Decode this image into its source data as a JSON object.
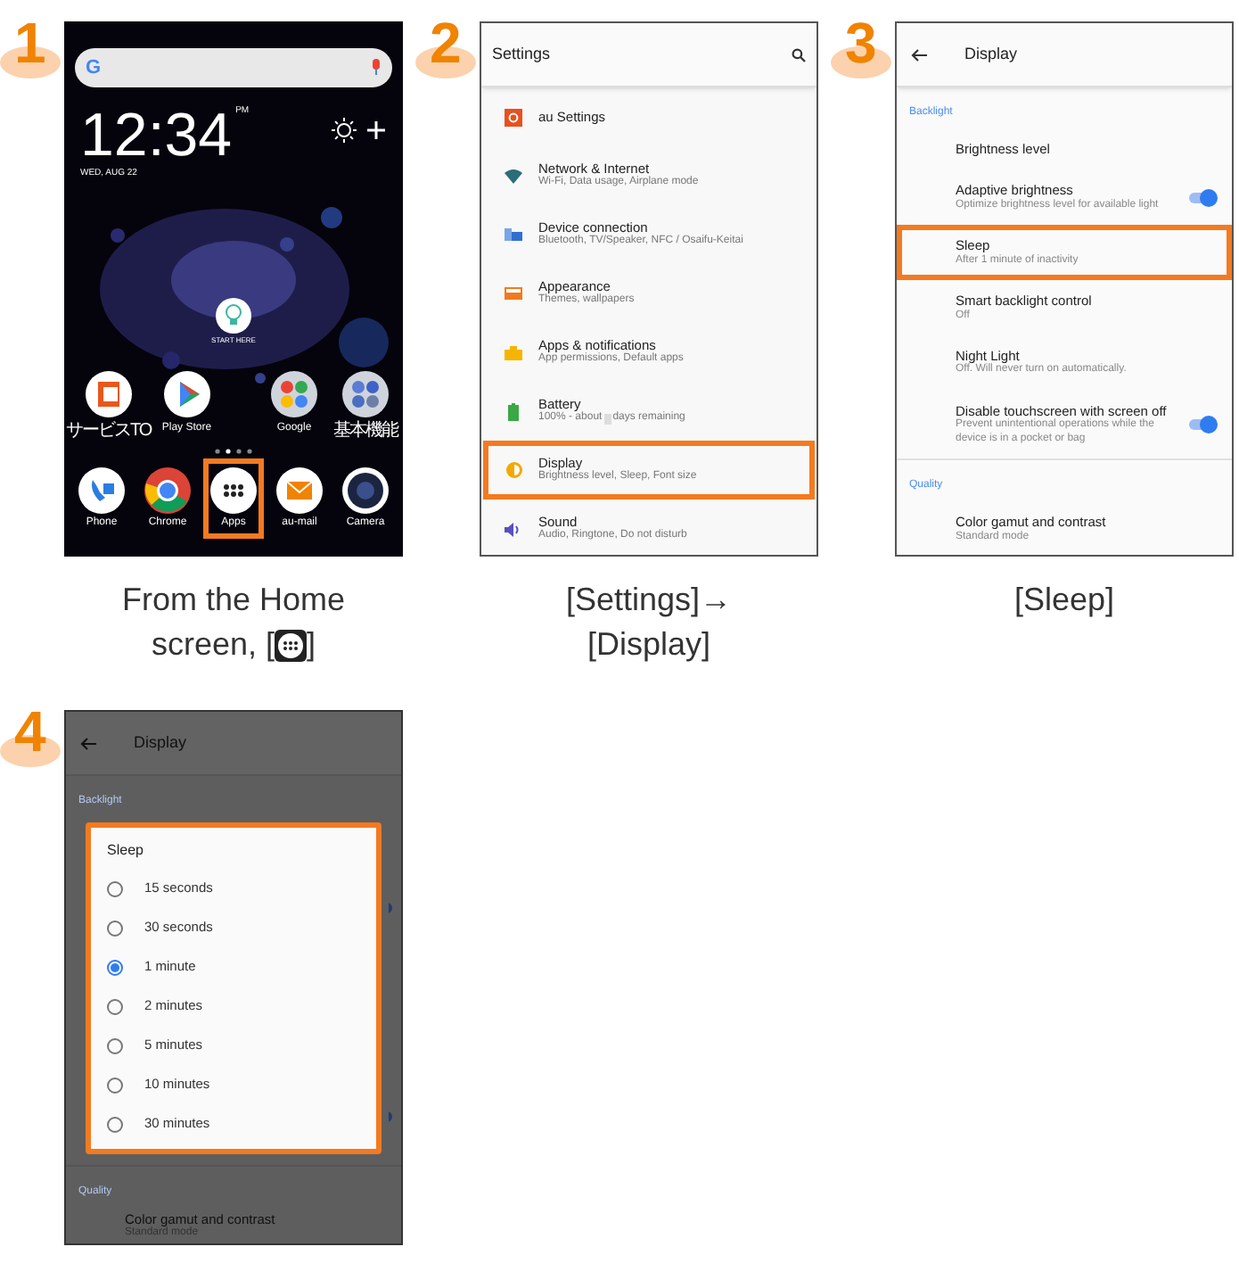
{
  "steps": [
    {
      "number": "1",
      "screen": {
        "kind": "home",
        "search_logo": "G",
        "time": "12:34",
        "ampm": "PM",
        "date": "WED, AUG 22",
        "start_here": "START HERE",
        "apps": [
          {
            "label": "サービスTO",
            "kind": "au"
          },
          {
            "label": "Play Store",
            "kind": "play"
          },
          {
            "label": "Google",
            "kind": "google-folder"
          },
          {
            "label": "基本機能",
            "kind": "basic-folder"
          }
        ],
        "dock": [
          {
            "label": "Phone",
            "kind": "phone",
            "highlighted": false
          },
          {
            "label": "Chrome",
            "kind": "chrome",
            "highlighted": false
          },
          {
            "label": "Apps",
            "kind": "apps",
            "highlighted": true
          },
          {
            "label": "au-mail",
            "kind": "mail",
            "highlighted": false
          },
          {
            "label": "Camera",
            "kind": "camera",
            "highlighted": false
          }
        ]
      },
      "caption": {
        "lines": [
          "From the Home",
          "screen, ["
        ],
        "after_icon": "]"
      }
    },
    {
      "number": "2",
      "screen": {
        "kind": "settings",
        "title": "Settings",
        "items": [
          {
            "title": "au Settings",
            "kind": "au",
            "highlighted": false
          },
          {
            "title": "Network & Internet",
            "subtitle": "Wi-Fi, Data usage, Airplane mode",
            "kind": "wifi",
            "highlighted": false
          },
          {
            "title": "Device connection",
            "subtitle": "Bluetooth, TV/Speaker, NFC / Osaifu-Keitai",
            "kind": "device",
            "highlighted": false
          },
          {
            "title": "Appearance",
            "subtitle": "Themes, wallpapers",
            "kind": "appearance",
            "highlighted": false
          },
          {
            "title": "Apps & notifications",
            "subtitle": "App permissions, Default apps",
            "kind": "apps",
            "highlighted": false
          },
          {
            "title": "Battery",
            "subtitle_parts": [
              "100% - about",
              "days remaining"
            ],
            "kind": "battery",
            "highlighted": false
          },
          {
            "title": "Display",
            "subtitle": "Brightness level, Sleep, Font size",
            "kind": "display",
            "highlighted": true
          },
          {
            "title": "Sound",
            "subtitle": "Audio, Ringtone, Do not disturb",
            "kind": "sound",
            "highlighted": false
          }
        ]
      },
      "caption": {
        "lines": [
          "[Settings]→",
          "[Display]"
        ]
      }
    },
    {
      "number": "3",
      "screen": {
        "kind": "display",
        "title": "Display",
        "sections": [
          {
            "label": "Backlight",
            "items": [
              {
                "title": "Brightness level",
                "kind": "plain",
                "highlighted": false
              },
              {
                "title": "Adaptive brightness",
                "subtitle": "Optimize brightness level for available light",
                "kind": "switch",
                "on": true,
                "highlighted": false
              },
              {
                "title": "Sleep",
                "subtitle": "After 1 minute of inactivity",
                "kind": "plain",
                "highlighted": true
              },
              {
                "title": "Smart backlight control",
                "subtitle": "Off",
                "kind": "plain",
                "highlighted": false
              },
              {
                "title": "Night Light",
                "subtitle": "Off. Will never turn on automatically.",
                "kind": "plain",
                "highlighted": false
              },
              {
                "title": "Disable touchscreen with screen off",
                "subtitle": "Prevent unintentional operations while the device is in a pocket or bag",
                "kind": "switch",
                "on": true,
                "highlighted": false
              }
            ]
          },
          {
            "label": "Quality",
            "items": [
              {
                "title": "Color gamut and contrast",
                "subtitle": "Standard mode",
                "kind": "plain",
                "highlighted": false
              }
            ]
          }
        ]
      },
      "caption": {
        "lines": [
          "[Sleep]"
        ]
      }
    },
    {
      "number": "4",
      "screen": {
        "kind": "dialog",
        "title": "Display",
        "backlight_label": "Backlight",
        "switches": [
          {
            "on": true
          },
          {
            "on": true
          }
        ],
        "quality_label": "Quality",
        "quality_item": {
          "title": "Color gamut and contrast",
          "subtitle": "Standard mode"
        },
        "dialog": {
          "title": "Sleep",
          "highlighted": true,
          "options": [
            {
              "label": "15 seconds",
              "selected": false
            },
            {
              "label": "30 seconds",
              "selected": false
            },
            {
              "label": "1 minute",
              "selected": true
            },
            {
              "label": "2 minutes",
              "selected": false
            },
            {
              "label": "5 minutes",
              "selected": false
            },
            {
              "label": "10 minutes",
              "selected": false
            },
            {
              "label": "30 minutes",
              "selected": false
            }
          ]
        }
      }
    }
  ]
}
